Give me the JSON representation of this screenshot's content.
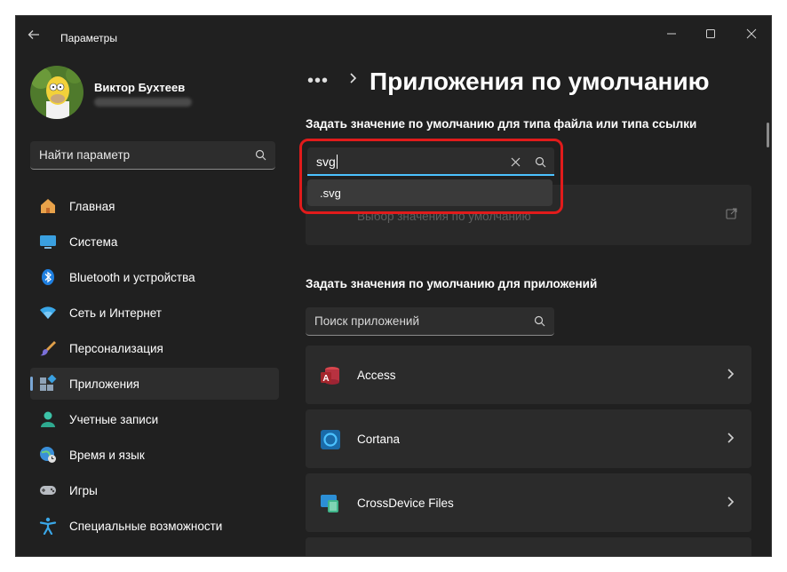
{
  "window": {
    "title": "Параметры",
    "controls": {
      "minimize": "minimize",
      "maximize": "maximize",
      "close": "close"
    }
  },
  "profile": {
    "name": "Виктор Бухтеев",
    "avatar_icon": "user-avatar"
  },
  "nav_search": {
    "placeholder": "Найти параметр"
  },
  "sidebar": {
    "items": [
      {
        "label": "Главная",
        "icon": "home-icon"
      },
      {
        "label": "Система",
        "icon": "system-icon"
      },
      {
        "label": "Bluetooth и устройства",
        "icon": "bluetooth-icon"
      },
      {
        "label": "Сеть и Интернет",
        "icon": "wifi-icon"
      },
      {
        "label": "Персонализация",
        "icon": "brush-icon"
      },
      {
        "label": "Приложения",
        "icon": "apps-icon",
        "active": true
      },
      {
        "label": "Учетные записи",
        "icon": "account-icon"
      },
      {
        "label": "Время и язык",
        "icon": "globe-clock-icon"
      },
      {
        "label": "Игры",
        "icon": "gamepad-icon"
      },
      {
        "label": "Специальные возможности",
        "icon": "accessibility-icon"
      }
    ]
  },
  "main": {
    "breadcrumb_more": "•••",
    "title": "Приложения по умолчанию",
    "filetype_section": {
      "heading": "Задать значение по умолчанию для типа файла или типа ссылки",
      "search_value": "svg",
      "suggestion": ".svg",
      "hidden_card_text": "Выбор значения по умолчанию"
    },
    "apps_section": {
      "heading": "Задать значения по умолчанию для приложений",
      "search_placeholder": "Поиск приложений",
      "apps": [
        {
          "name": "Access",
          "icon": "access-icon"
        },
        {
          "name": "Cortana",
          "icon": "cortana-icon"
        },
        {
          "name": "CrossDevice Files",
          "icon": "crossdevice-icon"
        }
      ]
    }
  },
  "colors": {
    "accent": "#4cc2ff",
    "highlight": "#e11b1b",
    "background": "#202020",
    "card": "#2b2b2b"
  }
}
